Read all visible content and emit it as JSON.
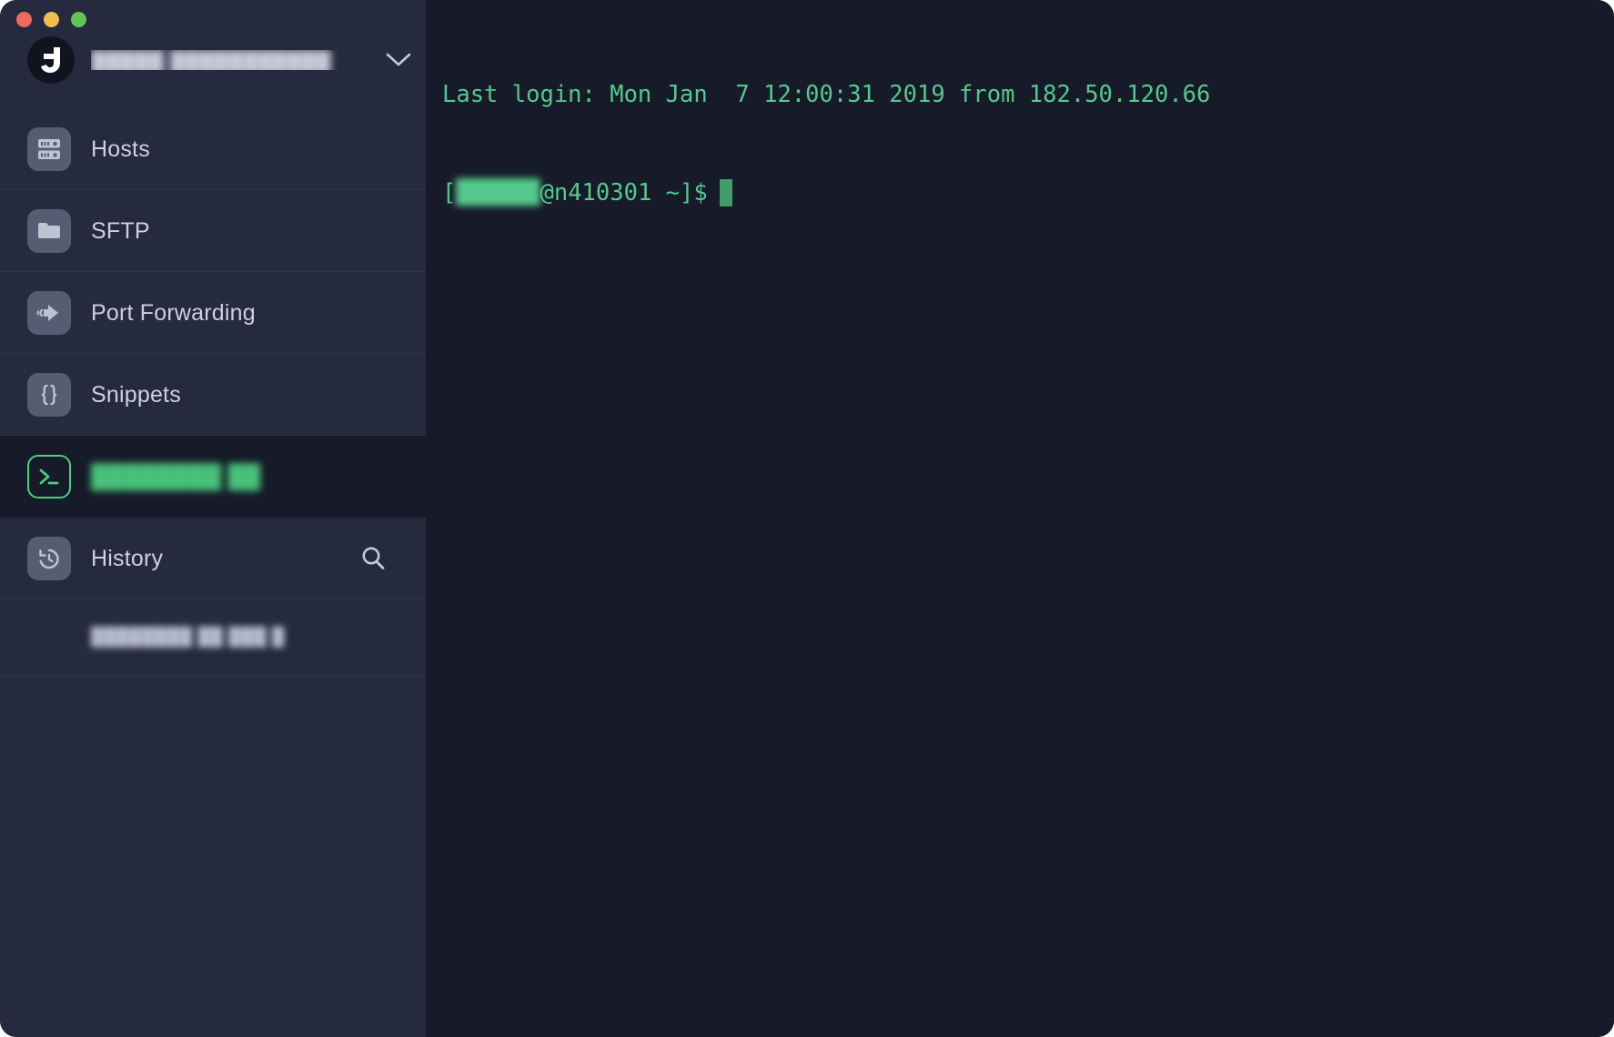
{
  "window": {
    "traffic_lights": [
      {
        "name": "close",
        "color": "#ed6a5e"
      },
      {
        "name": "minimize",
        "color": "#f4bd4f"
      },
      {
        "name": "maximize",
        "color": "#61c554"
      }
    ],
    "background": "#161a29",
    "sidebar_background": "#262a3e"
  },
  "sidebar": {
    "account": {
      "name": "█████ ███████████",
      "avatar_icon": "termius-logo-icon",
      "chevron_icon": "chevron-down-icon"
    },
    "items": [
      {
        "label": "Hosts",
        "icon": "server-rack-icon",
        "active": false
      },
      {
        "label": "SFTP",
        "icon": "folder-icon",
        "active": false
      },
      {
        "label": "Port Forwarding",
        "icon": "forward-arrow-icon",
        "active": false
      },
      {
        "label": "Snippets",
        "icon": "curly-braces-icon",
        "active": false
      },
      {
        "label": "████████ ██",
        "icon": "terminal-prompt-icon",
        "active": true
      },
      {
        "label": "History",
        "icon": "clock-history-icon",
        "active": false,
        "action_icon": "search-icon"
      }
    ],
    "history_entries": [
      {
        "label": "████████ ██ ███ █"
      }
    ],
    "accent_color": "#4ad07d"
  },
  "terminal": {
    "foreground": "#55c98c",
    "background": "#161a29",
    "cursor_color": "#3f9e68",
    "lines": [
      "Last login: Mon Jan  7 12:00:31 2019 from 182.50.120.66"
    ],
    "prompt": {
      "open_bracket": "[",
      "user": "██████",
      "host": "@n410301",
      "path": " ~]$"
    }
  }
}
